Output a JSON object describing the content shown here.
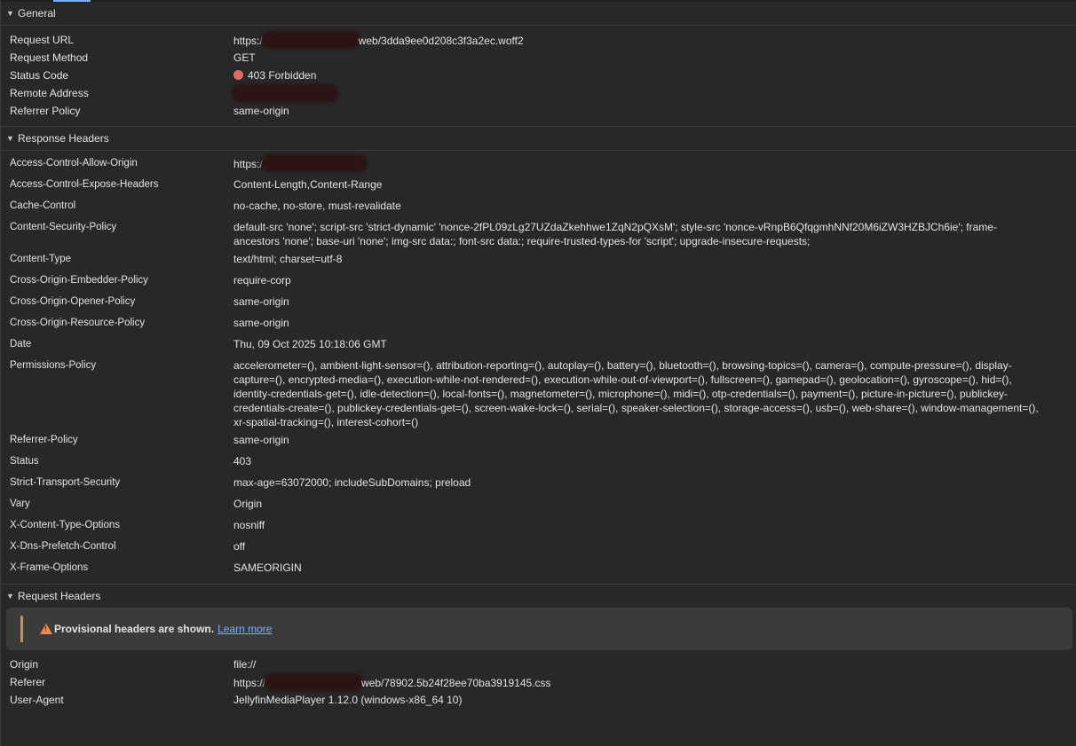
{
  "general": {
    "title": "General",
    "rows": [
      {
        "key": "Request URL",
        "pre": "https:/",
        "post": "web/3dda9ee0d208c3f3a2ec.woff2"
      },
      {
        "key": "Request Method",
        "value": "GET"
      },
      {
        "key": "Status Code",
        "value": "403 Forbidden",
        "status_color": "#e46962"
      },
      {
        "key": "Remote Address",
        "value": ""
      },
      {
        "key": "Referrer Policy",
        "value": "same-origin"
      }
    ]
  },
  "response_headers": {
    "title": "Response Headers",
    "rows": [
      {
        "key": "Access-Control-Allow-Origin",
        "value": "https:/"
      },
      {
        "key": "Access-Control-Expose-Headers",
        "value": "Content-Length,Content-Range"
      },
      {
        "key": "Cache-Control",
        "value": "no-cache, no-store, must-revalidate"
      },
      {
        "key": "Content-Security-Policy",
        "value": "default-src 'none'; script-src 'strict-dynamic' 'nonce-2fPL09zLg27UZdaZkehhwe1ZqN2pQXsM'; style-src 'nonce-vRnpB6QfqgmhNNf20M6iZW3HZBJCh6ie'; frame-ancestors 'none'; base-uri 'none'; img-src data:; font-src data:; require-trusted-types-for 'script'; upgrade-insecure-requests;"
      },
      {
        "key": "Content-Type",
        "value": "text/html; charset=utf-8"
      },
      {
        "key": "Cross-Origin-Embedder-Policy",
        "value": "require-corp"
      },
      {
        "key": "Cross-Origin-Opener-Policy",
        "value": "same-origin"
      },
      {
        "key": "Cross-Origin-Resource-Policy",
        "value": "same-origin"
      },
      {
        "key": "Date",
        "value": "Thu, 09 Oct 2025 10:18:06 GMT"
      },
      {
        "key": "Permissions-Policy",
        "value": "accelerometer=(), ambient-light-sensor=(), attribution-reporting=(), autoplay=(), battery=(), bluetooth=(), browsing-topics=(), camera=(), compute-pressure=(), display-capture=(), encrypted-media=(), execution-while-not-rendered=(), execution-while-out-of-viewport=(), fullscreen=(), gamepad=(), geolocation=(), gyroscope=(), hid=(), identity-credentials-get=(), idle-detection=(), local-fonts=(), magnetometer=(), microphone=(), midi=(), otp-credentials=(), payment=(), picture-in-picture=(), publickey-credentials-create=(), publickey-credentials-get=(), screen-wake-lock=(), serial=(), speaker-selection=(), storage-access=(), usb=(), web-share=(), window-management=(), xr-spatial-tracking=(), interest-cohort=()"
      },
      {
        "key": "Referrer-Policy",
        "value": "same-origin"
      },
      {
        "key": "Status",
        "value": "403"
      },
      {
        "key": "Strict-Transport-Security",
        "value": "max-age=63072000; includeSubDomains; preload"
      },
      {
        "key": "Vary",
        "value": "Origin"
      },
      {
        "key": "X-Content-Type-Options",
        "value": "nosniff"
      },
      {
        "key": "X-Dns-Prefetch-Control",
        "value": "off"
      },
      {
        "key": "X-Frame-Options",
        "value": "SAMEORIGIN"
      }
    ]
  },
  "request_headers": {
    "title": "Request Headers",
    "provisional": {
      "message": "Provisional headers are shown.",
      "link": "Learn more",
      "icon": "warning-icon",
      "accent_color": "#c49a3c"
    },
    "rows": [
      {
        "key": "Origin",
        "value": "file://"
      },
      {
        "key": "Referer",
        "pre": "https://",
        "post": "web/78902.5b24f28ee70ba3919145.css"
      },
      {
        "key": "User-Agent",
        "value": "JellyfinMediaPlayer 1.12.0 (windows-x86_64 10)"
      }
    ]
  }
}
